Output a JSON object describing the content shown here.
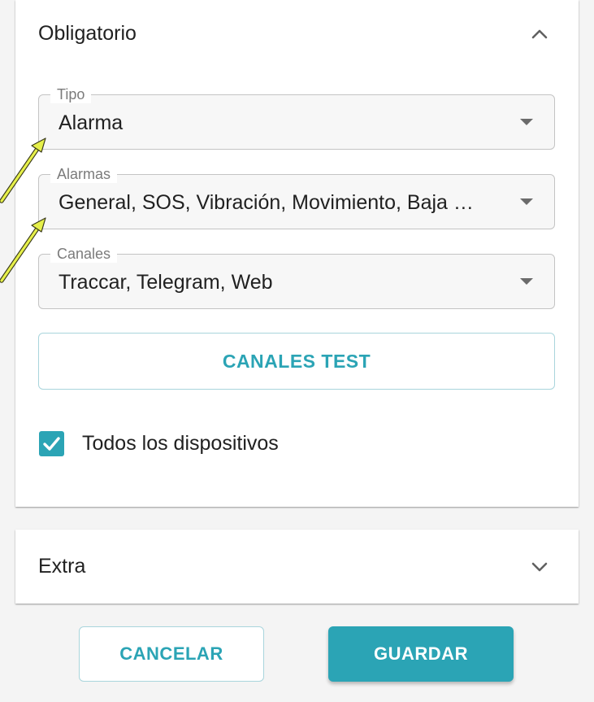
{
  "colors": {
    "accent": "#2ba4b5",
    "annotation_arrow": "#e6f04a"
  },
  "sections": {
    "required": {
      "title": "Obligatorio",
      "expanded": true,
      "icon": "chevron-up-icon"
    },
    "extra": {
      "title": "Extra",
      "expanded": false,
      "icon": "chevron-down-icon"
    }
  },
  "fields": {
    "type": {
      "label": "Tipo",
      "value": "Alarma"
    },
    "alarms": {
      "label": "Alarmas",
      "value": "General, SOS, Vibración, Movimiento, Baja …"
    },
    "channels": {
      "label": "Canales",
      "value": "Traccar, Telegram, Web"
    }
  },
  "buttons": {
    "test_channels": "CANALES TEST",
    "cancel": "CANCELAR",
    "save": "GUARDAR"
  },
  "checkbox": {
    "label": "Todos los dispositivos",
    "checked": true
  }
}
